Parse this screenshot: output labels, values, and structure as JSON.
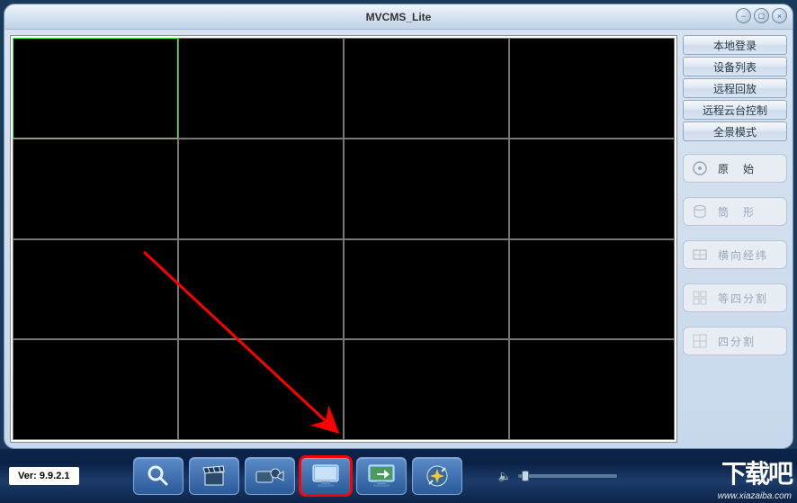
{
  "window": {
    "title": "MVCMS_Lite"
  },
  "sidebar": {
    "buttons": [
      {
        "label": "本地登录"
      },
      {
        "label": "设备列表"
      },
      {
        "label": "远程回放"
      },
      {
        "label": "远程云台控制"
      },
      {
        "label": "全景模式"
      }
    ],
    "modes": [
      {
        "label": "原　始",
        "icon": "disc-icon",
        "state": "active"
      },
      {
        "label": "筒　形",
        "icon": "cylinder-icon",
        "state": "disabled"
      },
      {
        "label": "横向经纬",
        "icon": "globe-icon",
        "state": "disabled"
      },
      {
        "label": "等四分割",
        "icon": "grid4-icon",
        "state": "disabled"
      },
      {
        "label": "四分割",
        "icon": "split4-icon",
        "state": "disabled"
      }
    ]
  },
  "video_grid": {
    "rows": 4,
    "cols": 4,
    "selected_index": 0
  },
  "toolbar": {
    "version_label": "Ver: 9.9.2.1",
    "icons": [
      {
        "name": "search-icon"
      },
      {
        "name": "clapper-icon"
      },
      {
        "name": "camcorder-icon"
      },
      {
        "name": "monitor-icon",
        "highlighted": true
      },
      {
        "name": "monitor-arrow-icon"
      },
      {
        "name": "settings-tool-icon"
      }
    ]
  },
  "watermark": {
    "brand": "下载吧",
    "url": "www.xiazaiba.com"
  }
}
